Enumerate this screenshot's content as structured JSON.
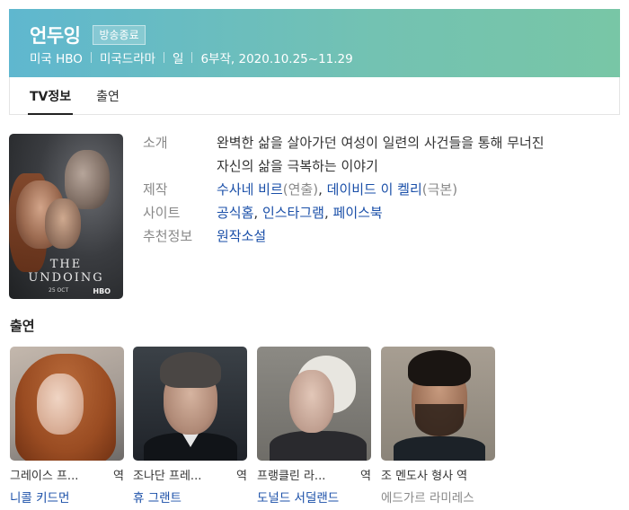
{
  "header": {
    "title": "언두잉",
    "badge": "방송종료",
    "meta": [
      "미국 HBO",
      "미국드라마",
      "일",
      "6부작, 2020.10.25~11.29"
    ]
  },
  "tabs": [
    {
      "label": "TV정보",
      "active": true
    },
    {
      "label": "출연",
      "active": false
    }
  ],
  "poster": {
    "title_text": "THE UNDOING",
    "date_text": "25 OCT",
    "network": "HBO"
  },
  "info": {
    "intro_label": "소개",
    "intro_line1": "완벽한 삶을 살아가던 여성이 일련의 사건들을 통해 무너진",
    "intro_line2": "자신의 삶을 극복하는 이야기",
    "production_label": "제작",
    "director_name": "수사네 비르",
    "director_role": "(연출)",
    "writer_name": "데이비드 이 켈리",
    "writer_role": "(극본)",
    "site_label": "사이트",
    "sites": [
      "공식홈",
      "인스타그램",
      "페이스북"
    ],
    "recommend_label": "추천정보",
    "recommend_value": "원작소설"
  },
  "cast": {
    "heading": "출연",
    "members": [
      {
        "role": "그레이스 프...",
        "suffix": "역",
        "name": "니콜 키드먼",
        "linked": true
      },
      {
        "role": "조나단 프레...",
        "suffix": "역",
        "name": "휴 그랜트",
        "linked": true
      },
      {
        "role": "프랭클린 라...",
        "suffix": "역",
        "name": "도널드 서덜랜드",
        "linked": true
      },
      {
        "role": "조 멘도사 형사",
        "suffix": "역",
        "name": "에드가르 라미레스",
        "linked": false
      }
    ]
  },
  "colors": {
    "header_gradient_start": "#5fb7cf",
    "header_gradient_end": "#78c6a6",
    "link": "#1a4fa8",
    "label_gray": "#888888"
  }
}
